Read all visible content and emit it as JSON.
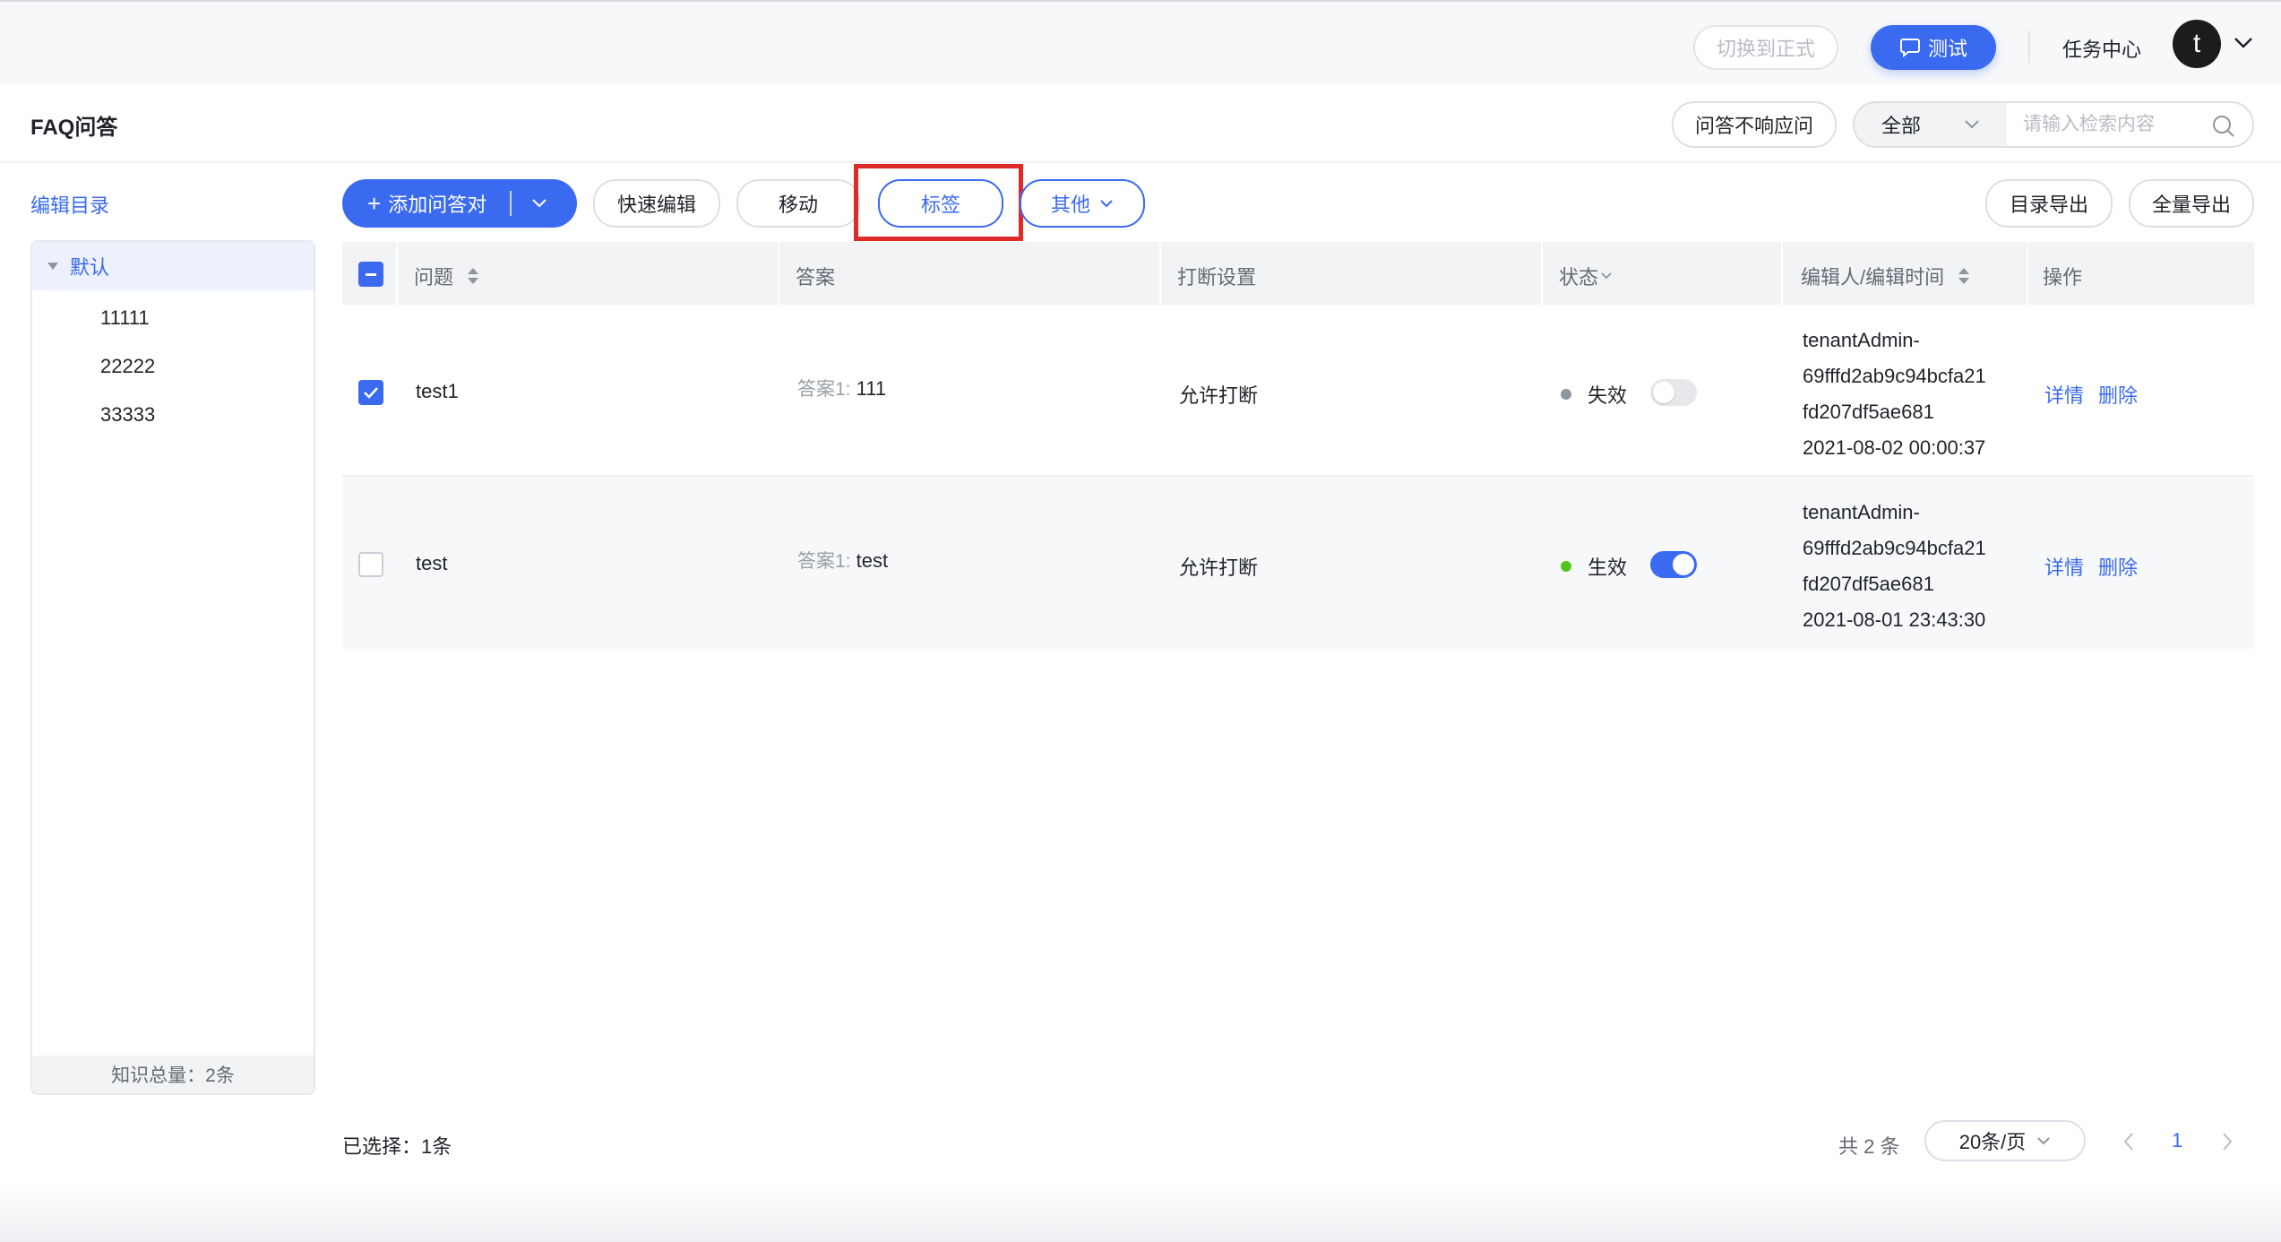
{
  "topbar": {
    "switch_formal": "切换到正式",
    "test_button": "测试",
    "task_center": "任务中心",
    "avatar_letter": "t"
  },
  "page": {
    "title": "FAQ问答",
    "no_response_button": "问答不响应问",
    "search_scope": "全部",
    "search_placeholder": "请输入检索内容"
  },
  "sidebar": {
    "edit_catalog": "编辑目录",
    "root": "默认",
    "children": [
      "11111",
      "22222",
      "33333"
    ],
    "footer": "知识总量：2条"
  },
  "toolbar": {
    "add_pair": "添加问答对",
    "quick_edit": "快速编辑",
    "move": "移动",
    "tag": "标签",
    "other": "其他",
    "export_catalog": "目录导出",
    "export_all": "全量导出"
  },
  "table": {
    "headers": {
      "question": "问题",
      "answer": "答案",
      "interrupt": "打断设置",
      "status": "状态",
      "editor": "编辑人/编辑时间",
      "action": "操作"
    },
    "rows": [
      {
        "checked": true,
        "question": "test1",
        "answer_label": "答案1:",
        "answer": "111",
        "interrupt": "允许打断",
        "status": "失效",
        "status_color": "#8f959e",
        "enabled": false,
        "editor_line1": "tenantAdmin-",
        "editor_line2": "69fffd2ab9c94bcfa21",
        "editor_line3": "fd207df5ae681",
        "edit_time": "2021-08-02 00:00:37",
        "detail": "详情",
        "delete": "删除"
      },
      {
        "checked": false,
        "question": "test",
        "answer_label": "答案1:",
        "answer": "test",
        "interrupt": "允许打断",
        "status": "生效",
        "status_color": "#52c41a",
        "enabled": true,
        "editor_line1": "tenantAdmin-",
        "editor_line2": "69fffd2ab9c94bcfa21",
        "editor_line3": "fd207df5ae681",
        "edit_time": "2021-08-01 23:43:30",
        "detail": "详情",
        "delete": "删除"
      }
    ]
  },
  "footer": {
    "selected": "已选择：1条",
    "total": "共 2 条",
    "page_size": "20条/页",
    "current_page": "1"
  },
  "colors": {
    "accent": "#3a6af0",
    "highlight": "#e02a2a"
  }
}
